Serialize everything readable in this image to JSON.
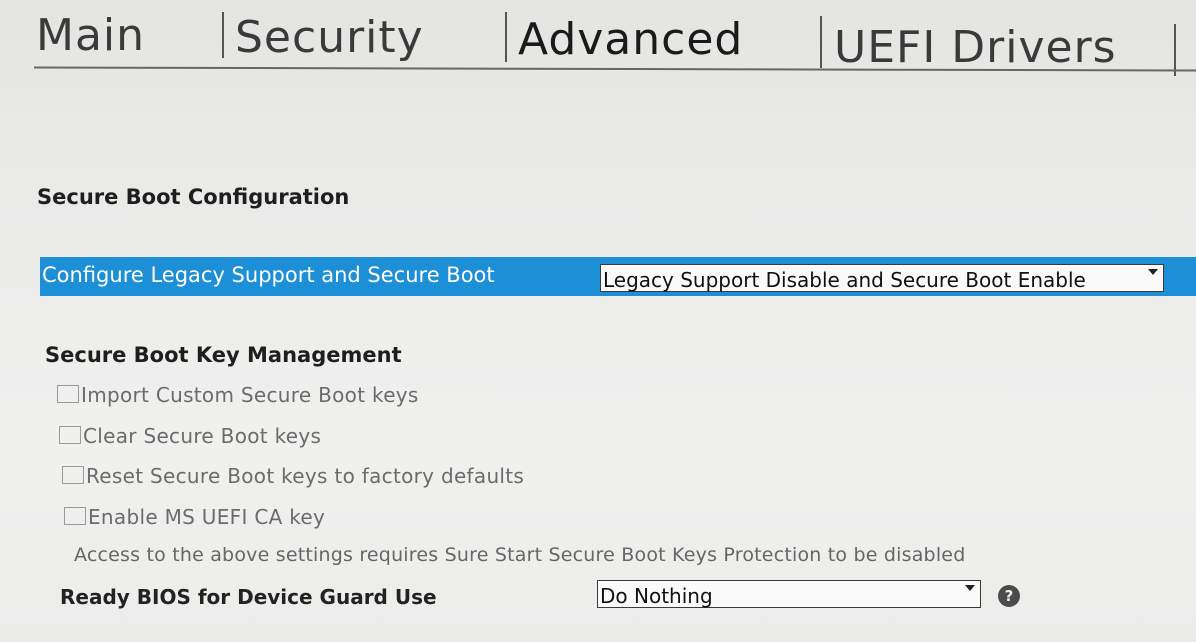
{
  "tabs": {
    "main": "Main",
    "security": "Security",
    "advanced": "Advanced",
    "uefi_drivers": "UEFI Drivers"
  },
  "secure_boot_configuration": {
    "title": "Secure Boot Configuration",
    "configure_label": "Configure Legacy Support and Secure Boot",
    "configure_value": "Legacy Support Disable and Secure Boot Enable"
  },
  "key_management": {
    "title": "Secure Boot Key Management",
    "items": [
      {
        "label": "Import Custom Secure Boot keys",
        "checked": false
      },
      {
        "label": "Clear Secure Boot keys",
        "checked": false
      },
      {
        "label": "Reset Secure Boot keys to factory defaults",
        "checked": false
      },
      {
        "label": "Enable MS UEFI CA key",
        "checked": false
      }
    ],
    "note": "Access to the above settings requires Sure Start Secure Boot Keys Protection to be disabled"
  },
  "device_guard": {
    "label": "Ready BIOS for Device Guard Use",
    "value": "Do Nothing",
    "help_glyph": "?"
  },
  "colors": {
    "highlight": "#1d8fd6",
    "background": "#ebebea"
  },
  "icons": {
    "dropdown": "chevron-down-icon",
    "help": "help-icon"
  }
}
